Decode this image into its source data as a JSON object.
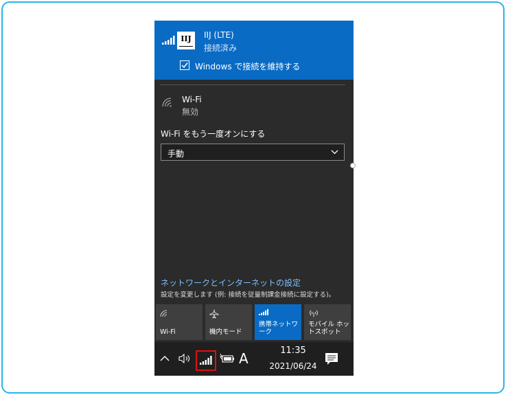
{
  "connection": {
    "name": "IIJ (LTE)",
    "status": "接続済み",
    "logo_text": "IIJ",
    "keep_connected_label": "Windows で接続を維持する",
    "keep_connected_checked": true
  },
  "wifi": {
    "name": "Wi-Fi",
    "status": "無効",
    "turn_on_label": "Wi-Fi をもう一度オンにする",
    "turn_on_selected": "手動"
  },
  "settings": {
    "link_label": "ネットワークとインターネットの設定",
    "description": "設定を変更します (例: 接続を従量制課金接続に設定する)。"
  },
  "tiles": [
    {
      "label": "Wi-Fi",
      "icon": "wifi-icon",
      "active": false
    },
    {
      "label": "機内モード",
      "icon": "airplane-icon",
      "active": false
    },
    {
      "label": "携帯ネットワーク",
      "icon": "cellular-icon",
      "active": true
    },
    {
      "label": "モバイル ホットスポット",
      "icon": "hotspot-icon",
      "active": false
    }
  ],
  "taskbar": {
    "ime_label": "A",
    "time": "11:35",
    "date": "2021/06/24"
  },
  "colors": {
    "accent": "#0a6bc4",
    "panel_bg": "#2b2b2b",
    "link": "#7fbfff",
    "highlight": "#e01010",
    "frame": "#2bb3e6"
  }
}
